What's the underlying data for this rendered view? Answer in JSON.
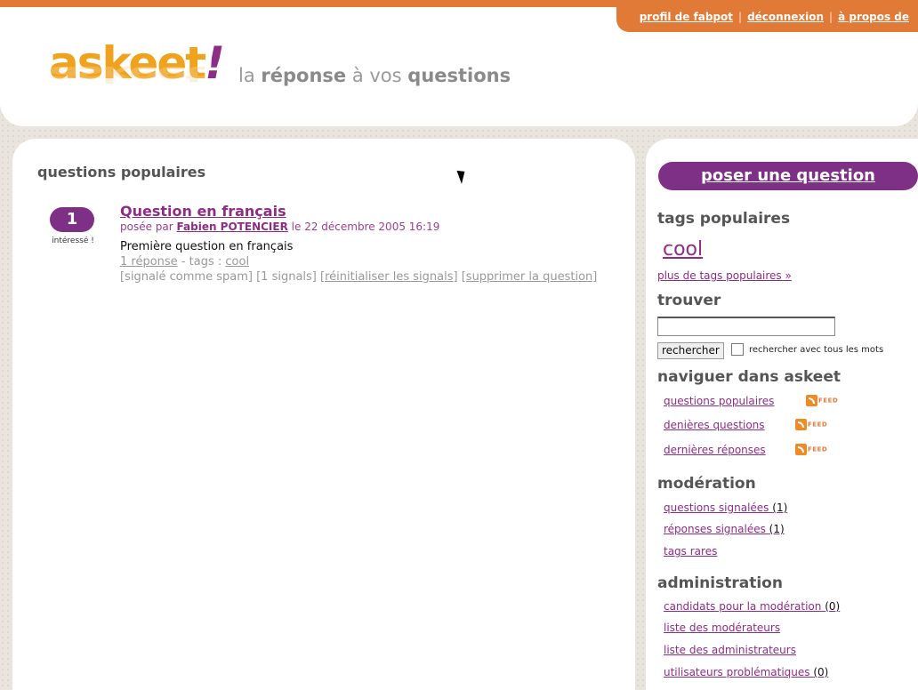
{
  "top_links": {
    "profile": "profil de fabpot",
    "logout": "déconnexion",
    "about": "à propos de"
  },
  "brand": {
    "logo_text": "askeet",
    "logo_bang": "!",
    "tagline_1": "la ",
    "tagline_2": "réponse",
    "tagline_3": " à vos ",
    "tagline_4": "questions"
  },
  "main": {
    "heading": "questions populaires",
    "questions": [
      {
        "interest_count": "1",
        "interest_label": "intéressé !",
        "title": "Question en français",
        "asked_by_prefix": "posée par",
        "author": "Fabien POTENCIER",
        "date": "le 22 décembre 2005 16:19",
        "body": "Première question en français",
        "answers_link": "1 réponse",
        "tags_prefix": " -  tags :",
        "tag": "cool",
        "spam_flag": "[signalé comme spam]",
        "signals": "[1 signals]",
        "reset_signals": "[réinitialiser les signals]",
        "delete_question": "[supprimer la question]"
      }
    ]
  },
  "sidebar": {
    "ask_button": "poser une question",
    "popular_tags_heading": "tags populaires",
    "popular_tag": "cool",
    "more_tags": "plus de tags populaires »",
    "find_heading": "trouver",
    "search_value": "",
    "search_button": "rechercher",
    "search_all_words": "rechercher avec tous les mots",
    "browse_heading": "naviguer dans askeet",
    "browse_items": [
      "questions populaires",
      "denières questions",
      "dernières réponses"
    ],
    "feed_label": "FEED",
    "moderation_heading": "modération",
    "moderation_items": [
      {
        "label": "questions signalées",
        "count": "(1)"
      },
      {
        "label": "réponses signalées",
        "count": "(1)"
      },
      {
        "label": "tags rares",
        "count": ""
      }
    ],
    "admin_heading": "administration",
    "admin_items": [
      {
        "label": "candidats pour la modération",
        "count": "(0)"
      },
      {
        "label": "liste des modérateurs",
        "count": ""
      },
      {
        "label": "liste des administrateurs",
        "count": ""
      },
      {
        "label": "utilisateurs problématiques",
        "count": "(0)"
      }
    ]
  },
  "colors": {
    "accent_orange": "#e07a36",
    "brand_purple": "#8f2c86",
    "logo_orange": "#f0a21d"
  }
}
